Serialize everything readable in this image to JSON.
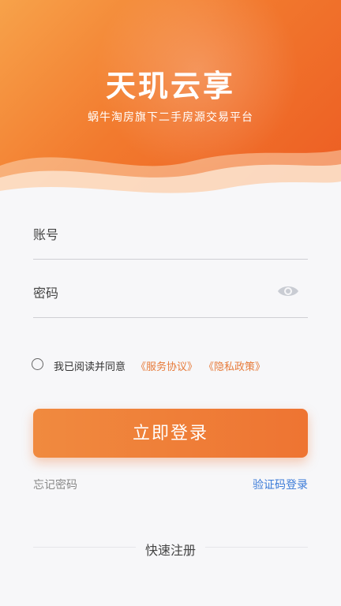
{
  "header": {
    "title": "天玑云享",
    "subtitle": "蜗牛淘房旗下二手房源交易平台",
    "gradient_colors": [
      "#f7a24a",
      "#f27a2e",
      "#ec5b22"
    ]
  },
  "form": {
    "account_label": "账号",
    "account_value": "",
    "password_label": "密码",
    "password_value": "",
    "eye_icon": "eye-icon"
  },
  "agreement": {
    "text": "我已阅读并同意",
    "service_link": "《服务协议》",
    "privacy_link": "《隐私政策》",
    "checked": false,
    "link_color": "#e77b3a"
  },
  "actions": {
    "login_button": "立即登录",
    "forgot_password": "忘记密码",
    "sms_login": "验证码登录",
    "quick_register": "快速注册",
    "accent_color": "#ee7432"
  }
}
